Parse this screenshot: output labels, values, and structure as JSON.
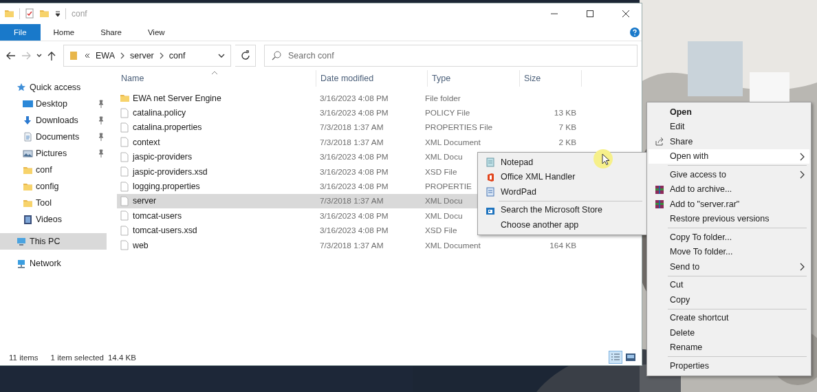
{
  "window": {
    "title": "conf",
    "ribbon_tabs": [
      {
        "label": "File",
        "selected": true
      },
      {
        "label": "Home",
        "selected": false
      },
      {
        "label": "Share",
        "selected": false
      },
      {
        "label": "View",
        "selected": false
      }
    ]
  },
  "address_bar": {
    "path": [
      "EWA",
      "server",
      "conf"
    ]
  },
  "search": {
    "placeholder": "Search conf"
  },
  "sidebar": {
    "items": [
      {
        "label": "Quick access",
        "kind": "star",
        "selected": false,
        "children": [
          {
            "label": "Desktop",
            "kind": "desktop",
            "pinned": true,
            "selected": false
          },
          {
            "label": "Downloads",
            "kind": "download",
            "pinned": true,
            "selected": false
          },
          {
            "label": "Documents",
            "kind": "documents",
            "pinned": true,
            "selected": false
          },
          {
            "label": "Pictures",
            "kind": "pictures",
            "pinned": true,
            "selected": false
          },
          {
            "label": "conf",
            "kind": "folder",
            "pinned": false,
            "selected": false
          },
          {
            "label": "config",
            "kind": "folder",
            "pinned": false,
            "selected": false
          },
          {
            "label": "Tool",
            "kind": "folder",
            "pinned": false,
            "selected": false
          },
          {
            "label": "Videos",
            "kind": "videos",
            "pinned": false,
            "selected": false
          }
        ]
      },
      {
        "label": "This PC",
        "kind": "pc",
        "selected": true
      },
      {
        "label": "Network",
        "kind": "network",
        "selected": false
      }
    ]
  },
  "table": {
    "columns": [
      {
        "label": "Name",
        "sorted": true
      },
      {
        "label": "Date modified",
        "sorted": false
      },
      {
        "label": "Type",
        "sorted": false
      },
      {
        "label": "Size",
        "sorted": false
      }
    ],
    "rows": [
      {
        "name": "EWA net Server Engine",
        "date": "3/16/2023 4:08 PM",
        "type": "File folder",
        "kind": "folder",
        "selected": false
      },
      {
        "name": "catalina.policy",
        "date": "3/16/2023 4:08 PM",
        "type": "POLICY File",
        "size": "13 KB",
        "kind": "file",
        "selected": false
      },
      {
        "name": "catalina.properties",
        "date": "7/3/2018 1:37 AM",
        "type": "PROPERTIES File",
        "size": "7 KB",
        "kind": "file",
        "selected": false
      },
      {
        "name": "context",
        "date": "7/3/2018 1:37 AM",
        "type": "XML Document",
        "size": "2 KB",
        "kind": "file",
        "selected": false
      },
      {
        "name": "jaspic-providers",
        "date": "3/16/2023 4:08 PM",
        "type": "XML Docu",
        "kind": "file",
        "selected": false
      },
      {
        "name": "jaspic-providers.xsd",
        "date": "3/16/2023 4:08 PM",
        "type": "XSD File",
        "kind": "file",
        "selected": false
      },
      {
        "name": "logging.properties",
        "date": "3/16/2023 4:08 PM",
        "type": "PROPERTIE",
        "kind": "file",
        "selected": false
      },
      {
        "name": "server",
        "date": "7/3/2018 1:37 AM",
        "type": "XML Docu",
        "kind": "file",
        "selected": true
      },
      {
        "name": "tomcat-users",
        "date": "3/16/2023 4:08 PM",
        "type": "XML Docu",
        "kind": "file",
        "selected": false
      },
      {
        "name": "tomcat-users.xsd",
        "date": "3/16/2023 4:08 PM",
        "type": "XSD File",
        "kind": "file",
        "selected": false
      },
      {
        "name": "web",
        "date": "7/3/2018 1:37 AM",
        "type": "XML Document",
        "size": "164 KB",
        "kind": "file",
        "selected": false
      }
    ]
  },
  "status_bar": {
    "item_count": "11 items",
    "selection": "1 item selected",
    "selection_size": "14.4 KB",
    "views": [
      {
        "kind": "details",
        "selected": true
      },
      {
        "kind": "tiles",
        "selected": false
      }
    ]
  },
  "open_with_menu": {
    "groups": [
      {
        "items": [
          {
            "label": "Notepad",
            "kind": "notepad",
            "highlighted": false
          },
          {
            "label": "Office XML Handler",
            "kind": "office",
            "highlighted": false
          },
          {
            "label": "WordPad",
            "kind": "wordpad",
            "highlighted": false
          }
        ]
      },
      {
        "items": [
          {
            "label": "Search the Microsoft Store",
            "kind": "store",
            "highlighted": false
          },
          {
            "label": "Choose another app",
            "kind": "plain",
            "highlighted": false
          }
        ]
      }
    ]
  },
  "context_menu": {
    "groups": [
      {
        "items": [
          {
            "label": "Open",
            "default": true,
            "highlighted": false,
            "submenu": false
          },
          {
            "label": "Edit",
            "default": false,
            "highlighted": false,
            "submenu": false
          },
          {
            "label": "Share",
            "kind": "share",
            "default": false,
            "highlighted": false,
            "submenu": false
          },
          {
            "label": "Open with",
            "default": false,
            "highlighted": true,
            "submenu": true
          }
        ]
      },
      {
        "items": [
          {
            "label": "Give access to",
            "default": false,
            "highlighted": false,
            "submenu": true
          },
          {
            "label": "Add to archive...",
            "kind": "archive",
            "default": false,
            "highlighted": false,
            "submenu": false
          },
          {
            "label": "Add to \"server.rar\"",
            "kind": "archive",
            "default": false,
            "highlighted": false,
            "submenu": false
          },
          {
            "label": "Restore previous versions",
            "default": false,
            "highlighted": false,
            "submenu": false
          }
        ]
      },
      {
        "items": [
          {
            "label": "Copy To folder...",
            "default": false,
            "highlighted": false,
            "submenu": false
          },
          {
            "label": "Move To folder...",
            "default": false,
            "highlighted": false,
            "submenu": false
          },
          {
            "label": "Send to",
            "default": false,
            "highlighted": false,
            "submenu": true
          }
        ]
      },
      {
        "items": [
          {
            "label": "Cut",
            "default": false,
            "highlighted": false,
            "submenu": false
          },
          {
            "label": "Copy",
            "default": false,
            "highlighted": false,
            "submenu": false
          }
        ]
      },
      {
        "items": [
          {
            "label": "Create shortcut",
            "default": false,
            "highlighted": false,
            "submenu": false
          },
          {
            "label": "Delete",
            "default": false,
            "highlighted": false,
            "submenu": false
          },
          {
            "label": "Rename",
            "default": false,
            "highlighted": false,
            "submenu": false
          }
        ]
      },
      {
        "items": [
          {
            "label": "Properties",
            "default": false,
            "highlighted": false,
            "submenu": false
          }
        ]
      }
    ]
  }
}
